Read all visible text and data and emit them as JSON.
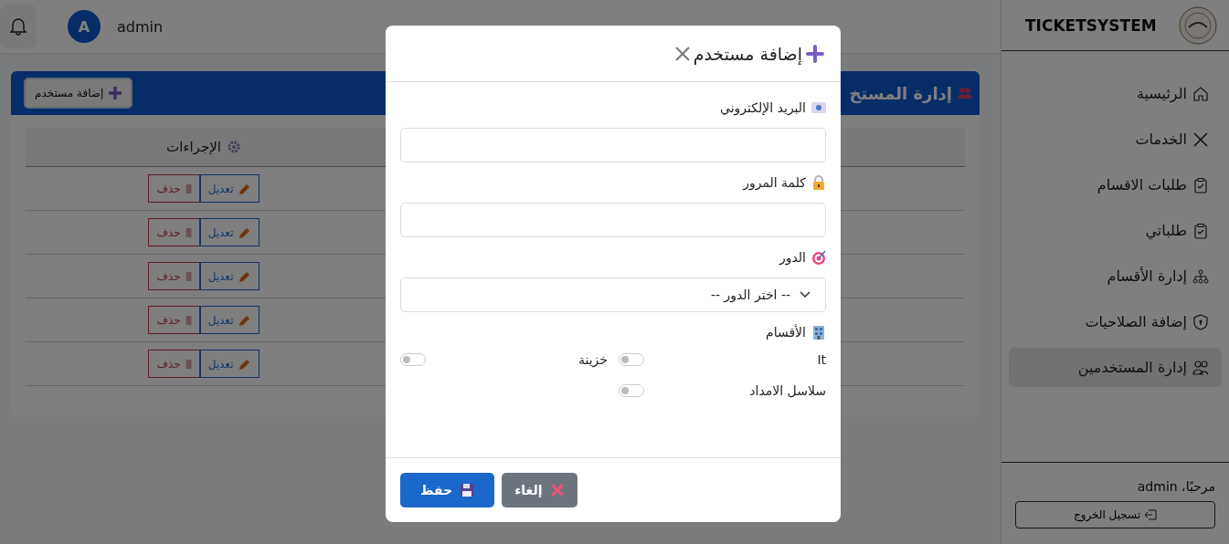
{
  "topbar": {
    "user_initial": "A",
    "username": "admin"
  },
  "page": {
    "title": "إدارة المستخ",
    "add_button": "إضافة مستخدم"
  },
  "table": {
    "columns": [
      "الإجراءات"
    ],
    "rows": [
      {
        "edit": "تعديل",
        "delete": "حذف"
      },
      {
        "edit": "تعديل",
        "delete": "حذف"
      },
      {
        "edit": "تعديل",
        "delete": "حذف"
      },
      {
        "edit": "تعديل",
        "delete": "حذف"
      },
      {
        "edit": "تعديل",
        "delete": "حذف"
      }
    ]
  },
  "sidebar": {
    "brand": "TICKETSYSTEM",
    "items": [
      {
        "label": "الرئيسية",
        "selected": false
      },
      {
        "label": "الخدمات",
        "selected": false
      },
      {
        "label": "طلبات الاقسام",
        "selected": false
      },
      {
        "label": "طلباتي",
        "selected": false
      },
      {
        "label": "إدارة الأقسام",
        "selected": false
      },
      {
        "label": "إضافة الصلاحيات",
        "selected": false
      },
      {
        "label": "إدارة المستخدمين",
        "selected": true
      }
    ],
    "greeting": "مرحبًا، admin",
    "logout": "تسجيل الخروج"
  },
  "modal": {
    "title": "إضافة مستخدم",
    "fields": [
      {
        "kind": "text",
        "label": "البريد الإلكتروني"
      },
      {
        "kind": "password",
        "label": "كلمة المرور"
      },
      {
        "kind": "select",
        "label": "الدور",
        "value": "-- اختر الدور --"
      }
    ],
    "departments_label": "الأقسام",
    "departments": [
      {
        "name": "It",
        "on": false
      },
      {
        "name": "خزينة",
        "on": false
      },
      {
        "name": "سلاسل الامداد",
        "on": false
      }
    ],
    "buttons": [
      {
        "kind": "cancel",
        "label": "إلغاء"
      },
      {
        "kind": "save",
        "label": "حفظ"
      }
    ]
  }
}
